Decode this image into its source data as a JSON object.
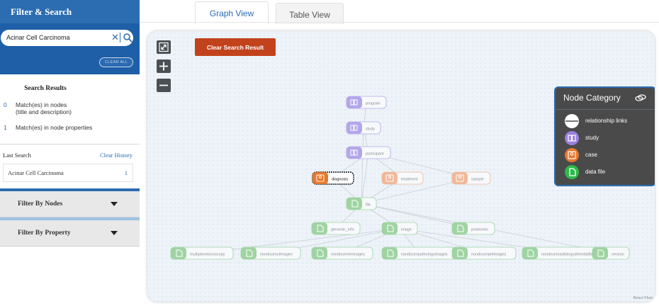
{
  "sidebar": {
    "title": "Filter & Search",
    "search": {
      "value": "Acinar Cell Carcinoma",
      "placeholder": ""
    },
    "clear_all_label": "CLEAR ALL",
    "results_title": "Search Results",
    "results": [
      {
        "count": "0",
        "label_line1": "Match(es) in nodes",
        "label_line2": "(title and description)"
      },
      {
        "count": "1",
        "label_line1": "Match(es) in node properties",
        "label_line2": ""
      }
    ],
    "last_search_label": "Last Search",
    "clear_history_label": "Clear History",
    "last_search_item": {
      "text": "Acinar Cell Carcinoma",
      "count": "1"
    },
    "filters": [
      {
        "label": "Filter By Nodes"
      },
      {
        "label": "Filter By Property"
      }
    ]
  },
  "tabs": [
    {
      "label": "Graph View",
      "active": true
    },
    {
      "label": "Table View",
      "active": false
    }
  ],
  "graph": {
    "clear_search_label": "Clear Search Result",
    "attribution": "React Flow",
    "legend": {
      "title": "Node Category",
      "items": [
        {
          "label": "relationship links",
          "icon": "relationship-links-icon",
          "color": "#ffffff"
        },
        {
          "label": "study",
          "icon": "study-icon",
          "color": "#9b7fe0"
        },
        {
          "label": "case",
          "icon": "case-icon",
          "color": "#e8782c"
        },
        {
          "label": "data file",
          "icon": "data-file-icon",
          "color": "#2fb84a"
        }
      ]
    },
    "colors": {
      "study": "#b3a6ea",
      "case": "#f0b89a",
      "data_file": "#9fd4a2",
      "highlight": "#e8782c"
    },
    "nodes": [
      {
        "id": "program",
        "label": "program",
        "category": "study"
      },
      {
        "id": "study",
        "label": "study",
        "category": "study"
      },
      {
        "id": "participant",
        "label": "participant",
        "category": "study"
      },
      {
        "id": "diagnosis",
        "label": "diagnosis",
        "category": "case",
        "highlighted": true
      },
      {
        "id": "treatment",
        "label": "treatment",
        "category": "case"
      },
      {
        "id": "sample",
        "label": "sample",
        "category": "case"
      },
      {
        "id": "file",
        "label": "file",
        "category": "data_file"
      },
      {
        "id": "genomic_info",
        "label": "genomic_info",
        "category": "data_file"
      },
      {
        "id": "image",
        "label": "image",
        "category": "data_file"
      },
      {
        "id": "proteomic",
        "label": "proteomic",
        "category": "data_file"
      },
      {
        "id": "multiplexmicroscopy",
        "label": "multiplexmicroscopy",
        "category": "data_file"
      },
      {
        "id": "nondicomctimages",
        "label": "nondicomctimages",
        "category": "data_file"
      },
      {
        "id": "nondicommrimages",
        "label": "nondicommrimages",
        "category": "data_file"
      },
      {
        "id": "nondicompathologyimages",
        "label": "nondicompathologyimages",
        "category": "data_file"
      },
      {
        "id": "nondicompetimages",
        "label": "nondicompetimages",
        "category": "data_file"
      },
      {
        "id": "nondicomradiologyallmodalities",
        "label": "nondicomradiologyallmodalities",
        "category": "data_file"
      },
      {
        "id": "version",
        "label": "version",
        "category": "data_file"
      }
    ],
    "edges": [
      [
        "program",
        "study"
      ],
      [
        "study",
        "participant"
      ],
      [
        "participant",
        "diagnosis"
      ],
      [
        "participant",
        "treatment"
      ],
      [
        "participant",
        "sample"
      ],
      [
        "participant",
        "file"
      ],
      [
        "study",
        "file"
      ],
      [
        "sample",
        "file"
      ],
      [
        "diagnosis",
        "file"
      ],
      [
        "treatment",
        "file"
      ],
      [
        "file",
        "genomic_info"
      ],
      [
        "file",
        "image"
      ],
      [
        "file",
        "proteomic"
      ],
      [
        "image",
        "multiplexmicroscopy"
      ],
      [
        "image",
        "nondicomctimages"
      ],
      [
        "image",
        "nondicommrimages"
      ],
      [
        "image",
        "nondicompathologyimages"
      ],
      [
        "image",
        "nondicompetimages"
      ],
      [
        "image",
        "nondicomradiologyallmodalities"
      ],
      [
        "file",
        "version"
      ]
    ]
  }
}
